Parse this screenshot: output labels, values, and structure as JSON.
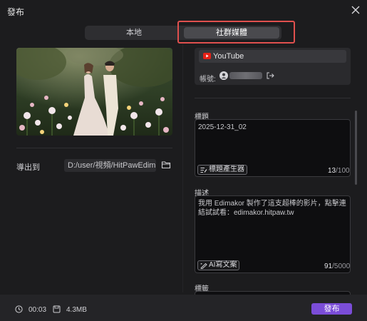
{
  "window": {
    "title": "發布"
  },
  "tabs": [
    {
      "label": "本地",
      "active": false
    },
    {
      "label": "社群媒體",
      "active": true
    }
  ],
  "export": {
    "label": "導出到",
    "path": "D:/user/視頻/HitPawEdimakor"
  },
  "platform": {
    "name": "YouTube",
    "account_label": "帳號:"
  },
  "title_field": {
    "label": "標題",
    "value": "2025-12-31_02",
    "generator_label": "標題產生器",
    "count": "13",
    "max": "/100"
  },
  "description_field": {
    "label": "描述",
    "value": "我用 Edimakor 製作了這支超棒的影片，點擊連結試試看：edimakor.hitpaw.tw",
    "ai_label": "AI寫文案",
    "count": "91",
    "max": "/5000"
  },
  "tags_field": {
    "label": "標籤"
  },
  "footer": {
    "duration": "00:03",
    "size": "4.3MB",
    "publish_label": "發布"
  },
  "colors": {
    "accent": "#7b4dd8",
    "highlight": "#e0504e",
    "youtube": "#e62117"
  }
}
